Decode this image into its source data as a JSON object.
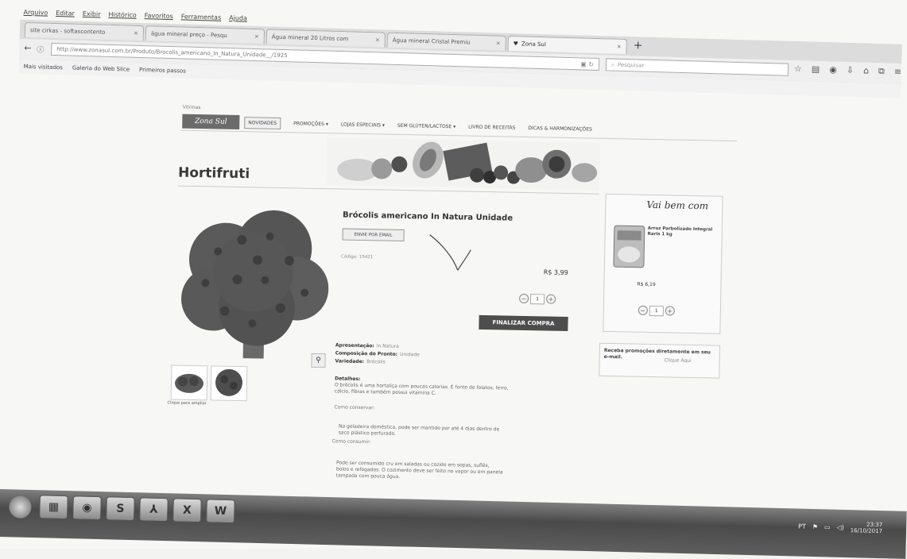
{
  "browser": {
    "menu": [
      "Arquivo",
      "Editar",
      "Exibir",
      "Histórico",
      "Favoritos",
      "Ferramentas",
      "Ajuda"
    ],
    "tabs": [
      {
        "label": "site cirkas - softascontento",
        "active": false
      },
      {
        "label": "água mineral preço - Pesqu",
        "active": false
      },
      {
        "label": "Água mineral 20 Litros com",
        "active": false
      },
      {
        "label": "Água mineral Cristal Premiu",
        "active": false
      },
      {
        "label": "Zona Sul",
        "active": true
      }
    ],
    "url": "http://www.zonasul.com.br/Produto/Brocolis_americano_In_Natura_Unidade__/1925",
    "search_placeholder": "Pesquisar",
    "bookmarks": [
      "Mais visitados",
      "Galeria do Web Slice",
      "Primeiros passos"
    ]
  },
  "site": {
    "breadcrumb": "Vitrinas",
    "logo": "Zona Sul",
    "nav": [
      "NOVIDADES",
      "PROMOÇÕES",
      "LOJAS ESPECIAIS",
      "SEM GLÚTEN/LACTOSE",
      "LIVRO DE RECEITAS",
      "DICAS & HARMONIZAÇÕES"
    ],
    "page_title": "Hortifruti"
  },
  "product": {
    "name": "Brócolis americano In Natura Unidade",
    "email_button": "ENVIE POR EMAIL",
    "code": "Código: 15421",
    "price": "R$ 3,99",
    "quantity": "1",
    "buy_button": "FINALIZAR COMPRA",
    "attributes": [
      {
        "label": "Apresentação:",
        "value": "In Natura"
      },
      {
        "label": "Composição do Pronto:",
        "value": "Unidade"
      },
      {
        "label": "Variedade:",
        "value": "Brócolis"
      }
    ],
    "details_title": "Detalhes:",
    "details_lines": [
      "O brócolis é uma hortaliça com poucas calorias. É fonte de folatos, ferro,",
      "cálcio, fibras e também possui vitamina C."
    ],
    "storage_label": "Como conservar:",
    "storage_lines": [
      "Na geladeira doméstica, pode ser mantido por até 4 dias dentro de",
      "saco plástico perfurado."
    ],
    "consume_label": "Como consumir:",
    "consume_lines": [
      "Pode ser consumido cru em saladas ou cozido em sopas, suflês,",
      "bolos e refogados. O cozimento deve ser feito no vapor ou em panela",
      "tampada com pouca água."
    ],
    "thumb_caption": "Clique para ampliar"
  },
  "sidebar": {
    "title": "Vai bem com",
    "item_name": "Arroz Parbolizado Integral Raris 1 kg",
    "item_price": "R$ 6,19",
    "item_quantity": "1",
    "promo_text": "Receba promoções diretamente em seu e-mail.",
    "promo_link": "Clique Aqui"
  },
  "taskbar": {
    "apps": [
      "firefox",
      "skype",
      "acrobat",
      "excel",
      "word"
    ],
    "time": "23:37",
    "date": "16/10/2017"
  },
  "colors": {
    "buy_button": "#4d4d4d",
    "logo": "#6b6b6b"
  }
}
